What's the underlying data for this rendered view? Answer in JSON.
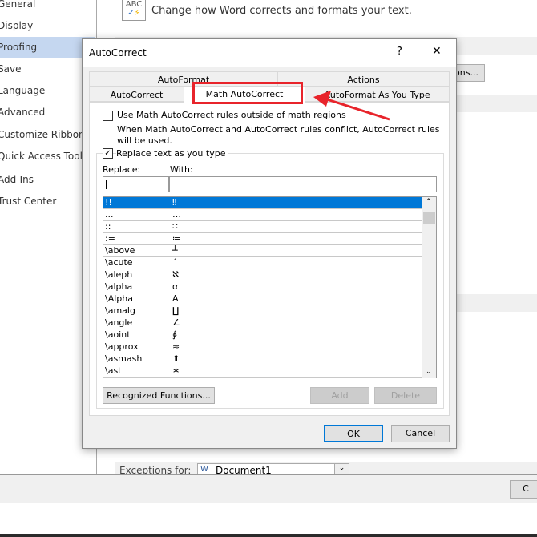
{
  "sidebar": {
    "items": [
      "General",
      "Display",
      "Proofing",
      "Save",
      "Language",
      "Advanced",
      "Customize Ribbon",
      "Quick Access Toolbar",
      "Add-Ins",
      "Trust Center"
    ],
    "selected": "Proofing"
  },
  "main": {
    "header_text": "Change how Word corrects and formats your text.",
    "options_button": "ons...",
    "exceptions_label": "Exceptions for:",
    "exceptions_value": "Document1",
    "bottom_button": "C"
  },
  "dialog": {
    "title": "AutoCorrect",
    "help": "?",
    "close": "✕",
    "tabs_row1": [
      "AutoFormat",
      "Actions"
    ],
    "tabs_row2": [
      "AutoCorrect",
      "Math AutoCorrect",
      "AutoFormat As You Type"
    ],
    "selected_tab": "Math AutoCorrect",
    "use_outside_label": "Use Math AutoCorrect rules outside of math regions",
    "use_outside_checked": false,
    "conflict_note": "When Math AutoCorrect and AutoCorrect rules conflict, AutoCorrect rules will be used.",
    "replace_label": "Replace text as you type",
    "replace_checked": true,
    "replace_col": "Replace:",
    "with_col": "With:",
    "replace_value": "",
    "with_value": "",
    "entries": [
      [
        "!!",
        "‼"
      ],
      [
        "...",
        "…"
      ],
      [
        "::",
        "∷"
      ],
      [
        ":=",
        "≔"
      ],
      [
        "\\above",
        "┴"
      ],
      [
        "\\acute",
        "´"
      ],
      [
        "\\aleph",
        "ℵ"
      ],
      [
        "\\alpha",
        "α"
      ],
      [
        "\\Alpha",
        "Α"
      ],
      [
        "\\amalg",
        "∐"
      ],
      [
        "\\angle",
        "∠"
      ],
      [
        "\\aoint",
        "∳"
      ],
      [
        "\\approx",
        "≈"
      ],
      [
        "\\asmash",
        "⬆"
      ],
      [
        "\\ast",
        "∗"
      ]
    ],
    "recognized_button": "Recognized Functions...",
    "add_button": "Add",
    "delete_button": "Delete",
    "ok_button": "OK",
    "cancel_button": "Cancel"
  },
  "colors": {
    "accent": "#0078d7",
    "highlight": "#e8242b",
    "sidebar_selected": "#c5d7f0"
  }
}
